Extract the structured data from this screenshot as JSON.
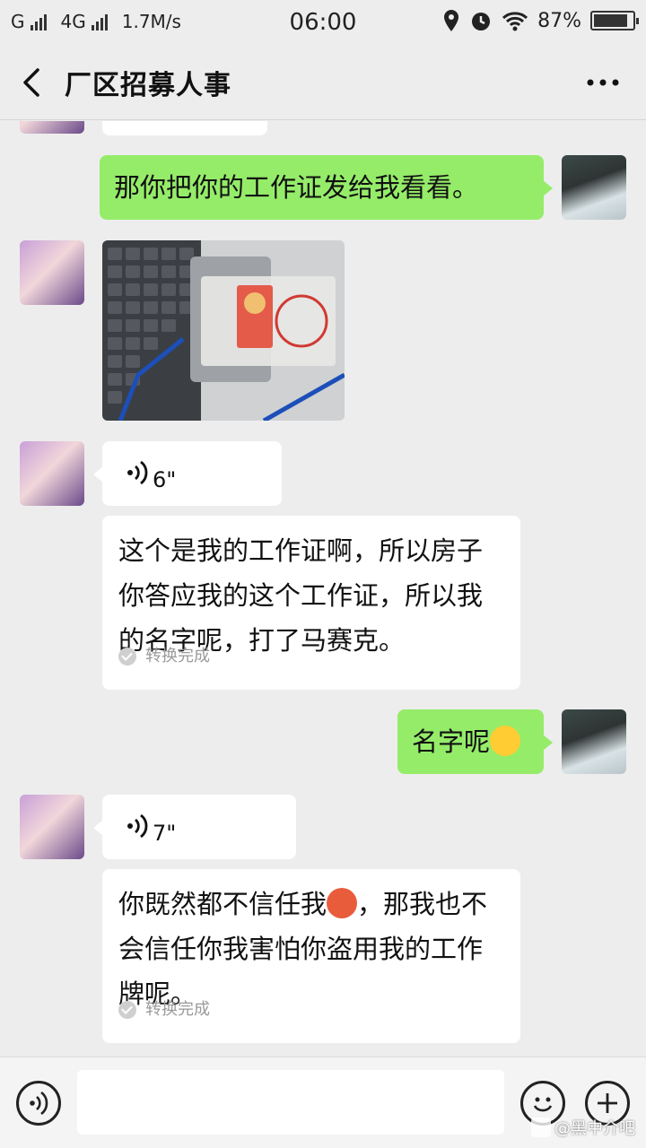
{
  "status": {
    "carrier1": "G",
    "carrier2": "4G",
    "speed": "1.7M/s",
    "time": "06:00",
    "battery": "87%",
    "battery_level": 0.87
  },
  "header": {
    "title": "厂区招募人事",
    "back_icon": "chevron-left-icon",
    "more_icon": "more-dots-icon"
  },
  "messages": {
    "m1": {
      "sender": "me",
      "text": "那你把你的工作证发给我看看。"
    },
    "m2": {
      "sender": "them",
      "type": "image"
    },
    "m3": {
      "sender": "them",
      "type": "voice",
      "duration": "6\""
    },
    "m4": {
      "sender": "them",
      "type": "transcript",
      "text": "这个是我的工作证啊，所以房子你答应我的这个工作证，所以我的名字呢，打了马赛克。",
      "status": "转换完成"
    },
    "m5": {
      "sender": "me",
      "text": "名字呢"
    },
    "m6": {
      "sender": "them",
      "type": "voice",
      "duration": "7\""
    },
    "m7": {
      "sender": "them",
      "type": "transcript",
      "text_before": "你既然都不信任我",
      "text_after": "，那我也不会信任你我害怕你盗用我的工作牌呢。",
      "status": "转换完成"
    }
  },
  "input": {
    "placeholder": ""
  },
  "watermark": {
    "text": "@黑中介吧"
  },
  "colors": {
    "sent_bubble": "#95ec69",
    "received_bubble": "#ffffff",
    "background": "#ededed"
  }
}
